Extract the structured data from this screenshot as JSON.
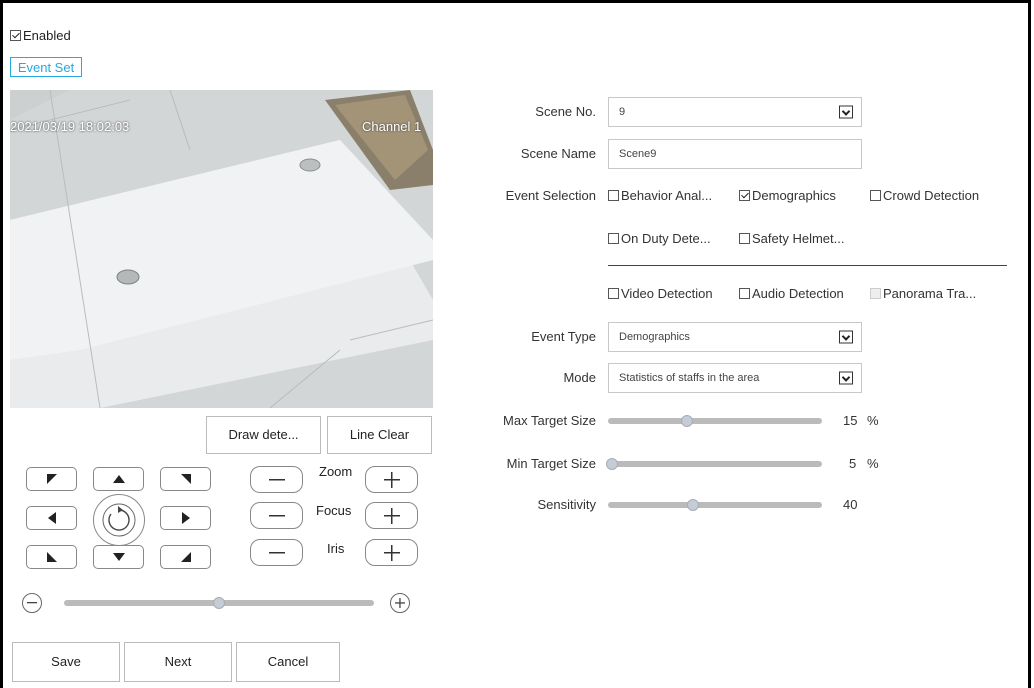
{
  "enabled": {
    "label": "Enabled",
    "checked": true
  },
  "tab": {
    "label": "Event Set"
  },
  "video": {
    "timestamp": "2021/03/19 18:02:03",
    "channel": "Channel 1"
  },
  "draw_buttons": {
    "draw": "Draw dete...",
    "clear": "Line Clear"
  },
  "ptz": {
    "lens": {
      "zoom": "Zoom",
      "focus": "Focus",
      "iris": "Iris"
    },
    "speed_level": 0.5
  },
  "footer": {
    "save": "Save",
    "next": "Next",
    "cancel": "Cancel"
  },
  "form": {
    "scene_no": {
      "label": "Scene No.",
      "value": "9"
    },
    "scene_name": {
      "label": "Scene Name",
      "value": "Scene9"
    },
    "event_selection": {
      "label": "Event Selection",
      "options": [
        {
          "label": "Behavior Anal...",
          "checked": false
        },
        {
          "label": "Demographics",
          "checked": true
        },
        {
          "label": "Crowd Detection",
          "checked": false
        },
        {
          "label": "On Duty Dete...",
          "checked": false
        },
        {
          "label": "Safety Helmet...",
          "checked": false
        }
      ],
      "other_options": [
        {
          "label": "Video Detection",
          "checked": false
        },
        {
          "label": "Audio Detection",
          "checked": false
        },
        {
          "label": "Panorama Tra...",
          "checked": false,
          "disabled": true
        }
      ]
    },
    "event_type": {
      "label": "Event Type",
      "value": "Demographics"
    },
    "mode": {
      "label": "Mode",
      "value": "Statistics of staffs in the area"
    },
    "max_target_size": {
      "label": "Max Target Size",
      "value": "15",
      "unit": "%"
    },
    "min_target_size": {
      "label": "Min Target Size",
      "value": "5",
      "unit": "%"
    },
    "sensitivity": {
      "label": "Sensitivity",
      "value": "40"
    }
  }
}
